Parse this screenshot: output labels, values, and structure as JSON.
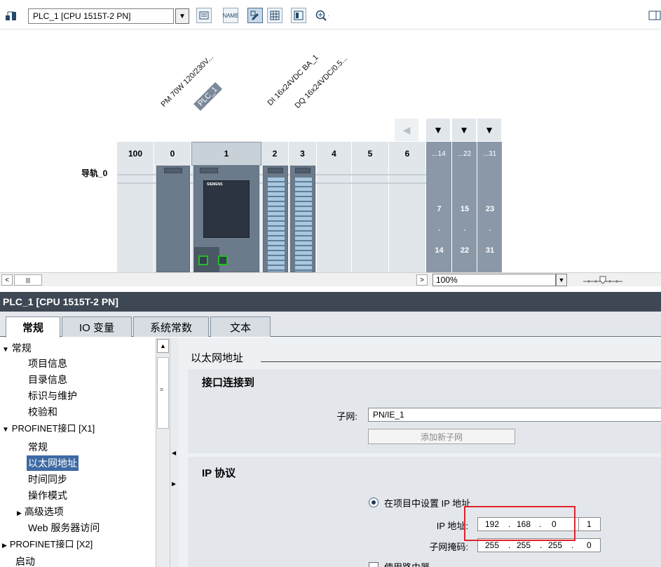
{
  "toolbar": {
    "device_select": "PLC_1 [CPU 1515T-2 PN]",
    "icons": [
      "network-view-icon",
      "device-overview-icon",
      "show-names-icon",
      "page-break-icon",
      "grid-icon",
      "table-icon",
      "zoom-icon"
    ],
    "name_btn_label": "NAME"
  },
  "device_view": {
    "module_labels": [
      "PM 70W 120/230V...",
      "PLC_1",
      "DI 16x24VDC BA_1",
      "DQ 16x24VDC/0.5..."
    ],
    "rail_label": "导轨_0",
    "slots": [
      "100",
      "0",
      "1",
      "2",
      "3",
      "4",
      "5",
      "6"
    ],
    "extra_slot_headers": [
      "...14",
      "...22",
      "...31"
    ],
    "extra_slot_ranges": [
      {
        "start": "7",
        "dash": "-",
        "end": "14"
      },
      {
        "start": "15",
        "dash": "-",
        "end": "22"
      },
      {
        "start": "23",
        "dash": "-",
        "end": "31"
      }
    ],
    "cpu_brand": "SIEMENS"
  },
  "scrollbar": {
    "zoom_level": "100%"
  },
  "properties": {
    "title": "PLC_1 [CPU 1515T-2 PN]",
    "tabs": [
      "常规",
      "IO 变量",
      "系统常数",
      "文本"
    ]
  },
  "tree": {
    "items": [
      {
        "label": "常规",
        "arrow": "▼"
      },
      {
        "label": "项目信息"
      },
      {
        "label": "目录信息"
      },
      {
        "label": "标识与维护"
      },
      {
        "label": "校验和"
      },
      {
        "label": "PROFINET接口 [X1]",
        "arrow": "▼"
      },
      {
        "label": "常规"
      },
      {
        "label": "以太网地址"
      },
      {
        "label": "时间同步"
      },
      {
        "label": "操作模式"
      },
      {
        "label": "高级选项",
        "arrow": "▶"
      },
      {
        "label": "Web 服务器访问"
      },
      {
        "label": "PROFINET接口 [X2]",
        "arrow": "▶"
      },
      {
        "label": "启动"
      }
    ]
  },
  "content": {
    "section_title": "以太网地址",
    "interface_group_title": "接口连接到",
    "subnet_label": "子网:",
    "subnet_value": "PN/IE_1",
    "add_subnet_button": "添加新子网",
    "ip_group_title": "IP 协议",
    "radio_set_ip_label": "在项目中设置 IP 地址",
    "ip_label": "IP 地址:",
    "ip_octets": [
      "192",
      "168",
      "0",
      "1"
    ],
    "mask_label": "子网掩码:",
    "mask_octets": [
      "255",
      "255",
      "255",
      "0"
    ],
    "router_label": "使用路由器"
  },
  "colors": {
    "title_bar": "#3e4854",
    "selection": "#3d6aa4",
    "highlight_box": "#e0232d"
  }
}
